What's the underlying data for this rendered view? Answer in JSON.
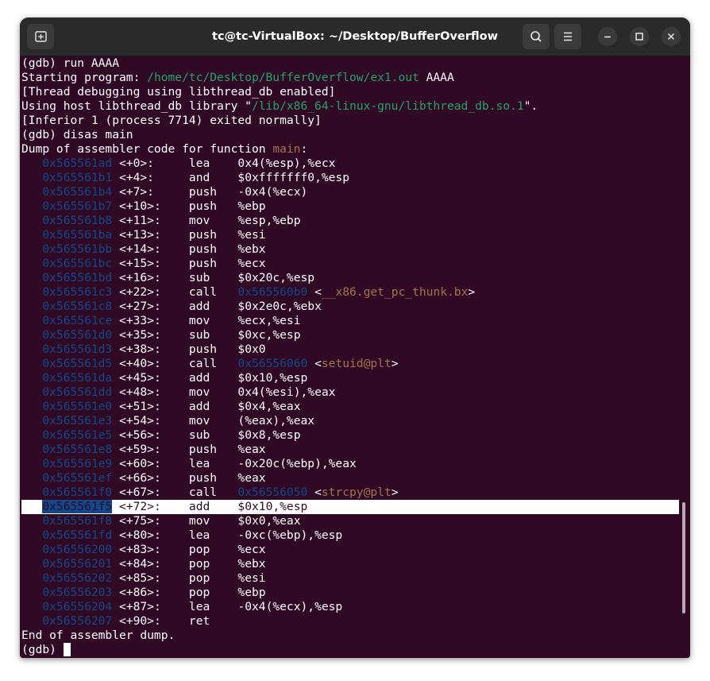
{
  "window": {
    "title": "tc@tc-VirtualBox: ~/Desktop/BufferOverflow"
  },
  "icons": {
    "new_tab": "new-tab-icon",
    "search": "search-icon",
    "menu": "hamburger-menu-icon",
    "minimize": "minimize-icon",
    "maximize": "maximize-icon",
    "close": "close-icon"
  },
  "colors": {
    "terminal_bg": "#300a24",
    "path_green": "#26a269",
    "address_blue": "#12488b",
    "symbol_brown": "#a2734c",
    "titlebar": "#2a2a2a"
  },
  "terminal": {
    "header_lines": [
      [
        {
          "t": "(gdb) run AAAA"
        }
      ],
      [
        {
          "t": "Starting program: "
        },
        {
          "t": "/home/tc/Desktop/BufferOverflow/ex1.out",
          "c": "green"
        },
        {
          "t": " AAAA"
        }
      ],
      [
        {
          "t": "[Thread debugging using libthread_db enabled]"
        }
      ],
      [
        {
          "t": "Using host libthread_db library \""
        },
        {
          "t": "/lib/x86_64-linux-gnu/libthread_db.so.1",
          "c": "green"
        },
        {
          "t": "\"."
        }
      ],
      [
        {
          "t": "[Inferior 1 (process 7714) exited normally]"
        }
      ],
      [
        {
          "t": "(gdb) disas main"
        }
      ],
      [
        {
          "t": "Dump of assembler code for function "
        },
        {
          "t": "main",
          "c": "sym"
        },
        {
          "t": ":"
        }
      ]
    ],
    "instructions": [
      {
        "addr": "0x565561ad",
        "off": "<+0>:",
        "op": "lea",
        "args": [
          {
            "t": "0x4(%esp),%ecx"
          }
        ]
      },
      {
        "addr": "0x565561b1",
        "off": "<+4>:",
        "op": "and",
        "args": [
          {
            "t": "$0xfffffff0,%esp"
          }
        ]
      },
      {
        "addr": "0x565561b4",
        "off": "<+7>:",
        "op": "push",
        "args": [
          {
            "t": "-0x4(%ecx)"
          }
        ]
      },
      {
        "addr": "0x565561b7",
        "off": "<+10>:",
        "op": "push",
        "args": [
          {
            "t": "%ebp"
          }
        ]
      },
      {
        "addr": "0x565561b8",
        "off": "<+11>:",
        "op": "mov",
        "args": [
          {
            "t": "%esp,%ebp"
          }
        ]
      },
      {
        "addr": "0x565561ba",
        "off": "<+13>:",
        "op": "push",
        "args": [
          {
            "t": "%esi"
          }
        ]
      },
      {
        "addr": "0x565561bb",
        "off": "<+14>:",
        "op": "push",
        "args": [
          {
            "t": "%ebx"
          }
        ]
      },
      {
        "addr": "0x565561bc",
        "off": "<+15>:",
        "op": "push",
        "args": [
          {
            "t": "%ecx"
          }
        ]
      },
      {
        "addr": "0x565561bd",
        "off": "<+16>:",
        "op": "sub",
        "args": [
          {
            "t": "$0x20c,%esp"
          }
        ]
      },
      {
        "addr": "0x565561c3",
        "off": "<+22>:",
        "op": "call",
        "args": [
          {
            "t": "0x565560b0",
            "c": "addr"
          },
          {
            "t": " <"
          },
          {
            "t": "__x86.get_pc_thunk.bx",
            "c": "sym"
          },
          {
            "t": ">"
          }
        ]
      },
      {
        "addr": "0x565561c8",
        "off": "<+27>:",
        "op": "add",
        "args": [
          {
            "t": "$0x2e0c,%ebx"
          }
        ]
      },
      {
        "addr": "0x565561ce",
        "off": "<+33>:",
        "op": "mov",
        "args": [
          {
            "t": "%ecx,%esi"
          }
        ]
      },
      {
        "addr": "0x565561d0",
        "off": "<+35>:",
        "op": "sub",
        "args": [
          {
            "t": "$0xc,%esp"
          }
        ]
      },
      {
        "addr": "0x565561d3",
        "off": "<+38>:",
        "op": "push",
        "args": [
          {
            "t": "$0x0"
          }
        ]
      },
      {
        "addr": "0x565561d5",
        "off": "<+40>:",
        "op": "call",
        "args": [
          {
            "t": "0x56556060",
            "c": "addr"
          },
          {
            "t": " <"
          },
          {
            "t": "setuid@plt",
            "c": "sym"
          },
          {
            "t": ">"
          }
        ]
      },
      {
        "addr": "0x565561da",
        "off": "<+45>:",
        "op": "add",
        "args": [
          {
            "t": "$0x10,%esp"
          }
        ]
      },
      {
        "addr": "0x565561dd",
        "off": "<+48>:",
        "op": "mov",
        "args": [
          {
            "t": "0x4(%esi),%eax"
          }
        ]
      },
      {
        "addr": "0x565561e0",
        "off": "<+51>:",
        "op": "add",
        "args": [
          {
            "t": "$0x4,%eax"
          }
        ]
      },
      {
        "addr": "0x565561e3",
        "off": "<+54>:",
        "op": "mov",
        "args": [
          {
            "t": "(%eax),%eax"
          }
        ]
      },
      {
        "addr": "0x565561e5",
        "off": "<+56>:",
        "op": "sub",
        "args": [
          {
            "t": "$0x8,%esp"
          }
        ]
      },
      {
        "addr": "0x565561e8",
        "off": "<+59>:",
        "op": "push",
        "args": [
          {
            "t": "%eax"
          }
        ]
      },
      {
        "addr": "0x565561e9",
        "off": "<+60>:",
        "op": "lea",
        "args": [
          {
            "t": "-0x20c(%ebp),%eax"
          }
        ]
      },
      {
        "addr": "0x565561ef",
        "off": "<+66>:",
        "op": "push",
        "args": [
          {
            "t": "%eax"
          }
        ]
      },
      {
        "addr": "0x565561f0",
        "off": "<+67>:",
        "op": "call",
        "args": [
          {
            "t": "0x56556050",
            "c": "addr"
          },
          {
            "t": " <"
          },
          {
            "t": "strcpy@plt",
            "c": "sym"
          },
          {
            "t": ">"
          }
        ]
      },
      {
        "addr": "0x565561f5",
        "off": "<+72>:",
        "op": "add",
        "args": [
          {
            "t": "$0x10,%esp"
          }
        ],
        "selected": true
      },
      {
        "addr": "0x565561f8",
        "off": "<+75>:",
        "op": "mov",
        "args": [
          {
            "t": "$0x0,%eax"
          }
        ]
      },
      {
        "addr": "0x565561fd",
        "off": "<+80>:",
        "op": "lea",
        "args": [
          {
            "t": "-0xc(%ebp),%esp"
          }
        ]
      },
      {
        "addr": "0x56556200",
        "off": "<+83>:",
        "op": "pop",
        "args": [
          {
            "t": "%ecx"
          }
        ]
      },
      {
        "addr": "0x56556201",
        "off": "<+84>:",
        "op": "pop",
        "args": [
          {
            "t": "%ebx"
          }
        ]
      },
      {
        "addr": "0x56556202",
        "off": "<+85>:",
        "op": "pop",
        "args": [
          {
            "t": "%esi"
          }
        ]
      },
      {
        "addr": "0x56556203",
        "off": "<+86>:",
        "op": "pop",
        "args": [
          {
            "t": "%ebp"
          }
        ]
      },
      {
        "addr": "0x56556204",
        "off": "<+87>:",
        "op": "lea",
        "args": [
          {
            "t": "-0x4(%ecx),%esp"
          }
        ]
      },
      {
        "addr": "0x56556207",
        "off": "<+90>:",
        "op": "ret",
        "args": []
      }
    ],
    "end_line": "End of assembler dump.",
    "prompt": "(gdb) "
  }
}
